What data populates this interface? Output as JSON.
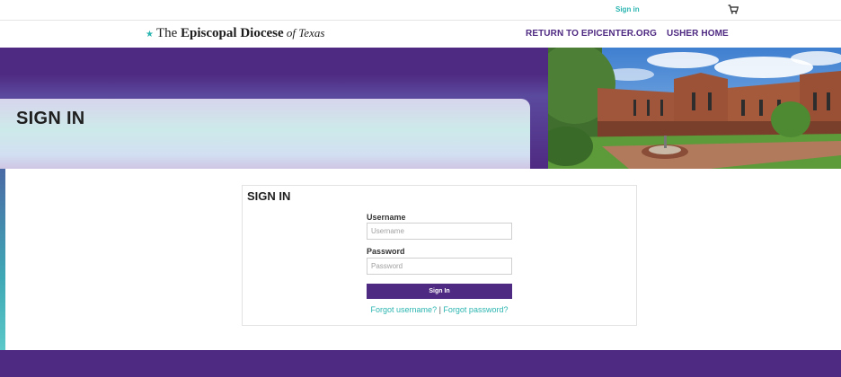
{
  "topbar": {
    "signin_label": "Sign in",
    "cart_icon": "cart-icon"
  },
  "header": {
    "logo_pre": "The ",
    "logo_bold": "Episcopal Diocese",
    "logo_of": " of ",
    "logo_texas": "Texas",
    "nav": {
      "return_label": "RETURN TO EPICENTER.ORG",
      "usher_label": "USHER HOME"
    }
  },
  "banner": {
    "title": "SIGN IN",
    "photo": "courtyard-building-photo"
  },
  "signin_form": {
    "title": "SIGN IN",
    "username_label": "Username",
    "username_placeholder": "Username",
    "username_value": "",
    "password_label": "Password",
    "password_placeholder": "Password",
    "password_value": "",
    "submit_label": "Sign In",
    "forgot_username": "Forgot username?",
    "separator": " | ",
    "forgot_password": "Forgot password?"
  },
  "colors": {
    "brand_purple": "#4f2a82",
    "accent_teal": "#2bb5b0"
  }
}
